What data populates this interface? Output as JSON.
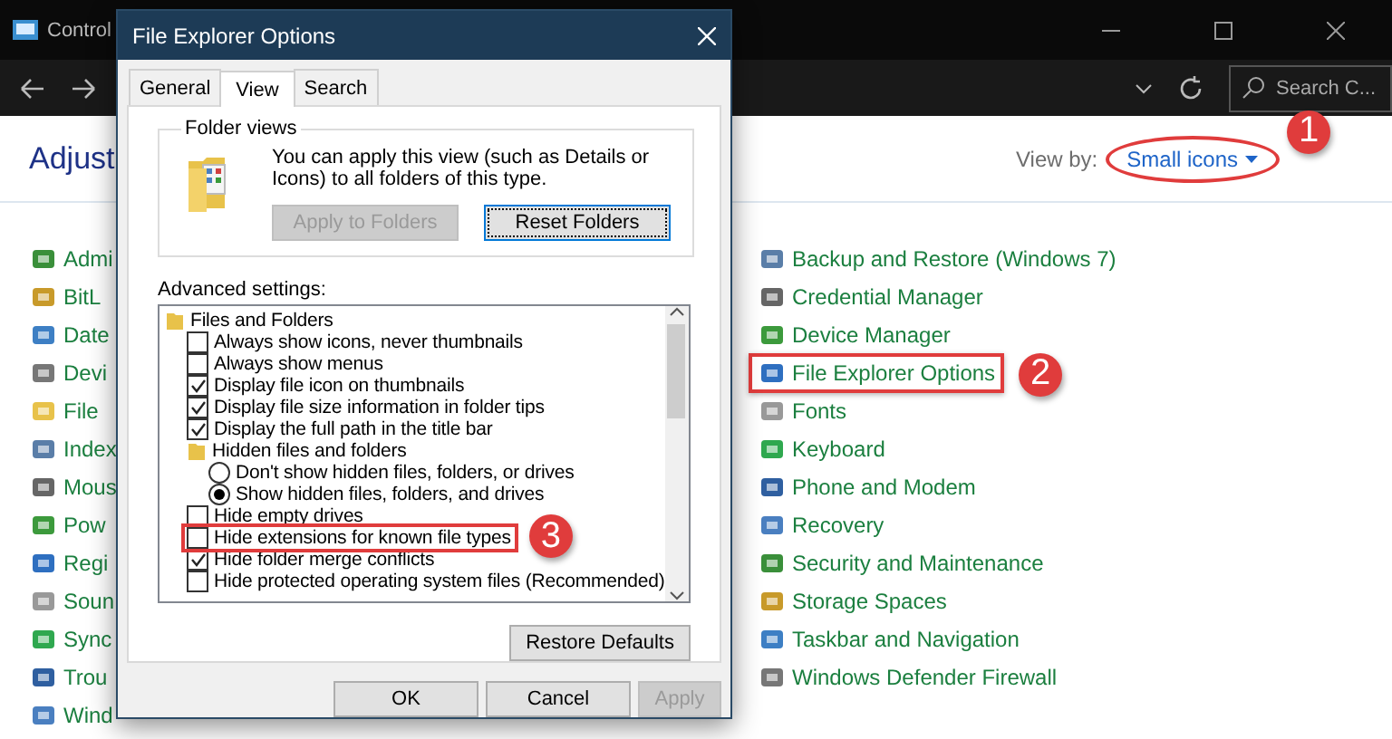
{
  "control_panel": {
    "window": {
      "title": "Control"
    },
    "search": {
      "placeholder": "Search C..."
    },
    "heading": "Adjust",
    "view_by": {
      "label": "View by:",
      "value": "Small icons",
      "annotation": "1"
    },
    "left_items": [
      {
        "label": "Admi"
      },
      {
        "label": "BitL"
      },
      {
        "label": "Date"
      },
      {
        "label": "Devi"
      },
      {
        "label": "File"
      },
      {
        "label": "Index"
      },
      {
        "label": "Mous"
      },
      {
        "label": "Pow"
      },
      {
        "label": "Regi"
      },
      {
        "label": "Soun"
      },
      {
        "label": "Sync"
      },
      {
        "label": "Trou"
      },
      {
        "label": "Wind"
      }
    ],
    "right_items": [
      {
        "label": "Backup and Restore (Windows 7)"
      },
      {
        "label": "Credential Manager"
      },
      {
        "label": "Device Manager"
      },
      {
        "label": "File Explorer Options",
        "annotation": "2"
      },
      {
        "label": "Fonts"
      },
      {
        "label": "Keyboard"
      },
      {
        "label": "Phone and Modem"
      },
      {
        "label": "Recovery"
      },
      {
        "label": "Security and Maintenance"
      },
      {
        "label": "Storage Spaces"
      },
      {
        "label": "Taskbar and Navigation"
      },
      {
        "label": "Windows Defender Firewall"
      }
    ]
  },
  "dialog": {
    "title": "File Explorer Options",
    "tabs": [
      {
        "label": "General",
        "selected": false
      },
      {
        "label": "View",
        "selected": true
      },
      {
        "label": "Search",
        "selected": false
      }
    ],
    "folder_views": {
      "title": "Folder views",
      "text": "You can apply this view (such as Details or Icons) to all folders of this type.",
      "buttons": [
        {
          "label": "Apply to Folders",
          "disabled": true,
          "focused": false
        },
        {
          "label": "Reset Folders",
          "disabled": false,
          "focused": true
        }
      ]
    },
    "advanced_label": "Advanced settings:",
    "settings": [
      {
        "kind": "folder",
        "label": "Files and Folders",
        "children": [
          {
            "kind": "checkbox",
            "label": "Always show icons, never thumbnails",
            "checked": false
          },
          {
            "kind": "checkbox",
            "label": "Always show menus",
            "checked": false
          },
          {
            "kind": "checkbox",
            "label": "Display file icon on thumbnails",
            "checked": true
          },
          {
            "kind": "checkbox",
            "label": "Display file size information in folder tips",
            "checked": true
          },
          {
            "kind": "checkbox",
            "label": "Display the full path in the title bar",
            "checked": true
          },
          {
            "kind": "folder",
            "label": "Hidden files and folders",
            "children": [
              {
                "kind": "radio",
                "label": "Don't show hidden files, folders, or drives",
                "selected": false
              },
              {
                "kind": "radio",
                "label": "Show hidden files, folders, and drives",
                "selected": true
              }
            ]
          },
          {
            "kind": "checkbox",
            "label": "Hide empty drives",
            "checked": false
          },
          {
            "kind": "checkbox",
            "label": "Hide extensions for known file types",
            "checked": false,
            "annotation": "3"
          },
          {
            "kind": "checkbox",
            "label": "Hide folder merge conflicts",
            "checked": true
          },
          {
            "kind": "checkbox",
            "label": "Hide protected operating system files (Recommended)",
            "checked": false
          }
        ]
      }
    ],
    "restore_button": "Restore Defaults",
    "buttons": [
      {
        "label": "OK",
        "disabled": false
      },
      {
        "label": "Cancel",
        "disabled": false
      },
      {
        "label": "Apply",
        "disabled": true
      }
    ]
  }
}
